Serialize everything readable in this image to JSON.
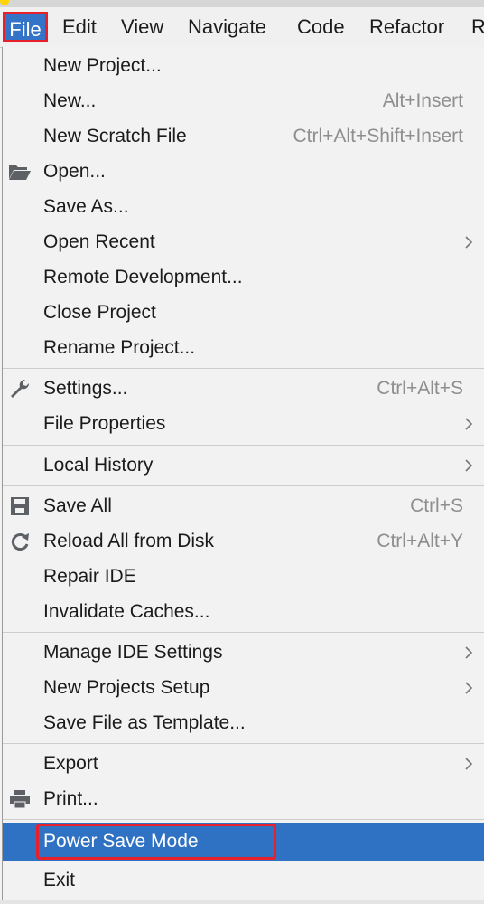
{
  "menubar": {
    "items": [
      "File",
      "Edit",
      "View",
      "Navigate",
      "Code",
      "Refactor",
      "R"
    ]
  },
  "file_menu": {
    "items": [
      {
        "label": "New Project...",
        "shortcut": "",
        "submenu": false
      },
      {
        "label": "New...",
        "shortcut": "Alt+Insert",
        "submenu": false
      },
      {
        "label": "New Scratch File",
        "shortcut": "Ctrl+Alt+Shift+Insert",
        "submenu": false
      },
      {
        "label": "Open...",
        "shortcut": "",
        "submenu": false,
        "icon": "folder-open-icon"
      },
      {
        "label": "Save As...",
        "shortcut": "",
        "submenu": false
      },
      {
        "label": "Open Recent",
        "shortcut": "",
        "submenu": true
      },
      {
        "label": "Remote Development...",
        "shortcut": "",
        "submenu": false
      },
      {
        "label": "Close Project",
        "shortcut": "",
        "submenu": false
      },
      {
        "label": "Rename Project...",
        "shortcut": "",
        "submenu": false
      },
      {
        "label": "Settings...",
        "shortcut": "Ctrl+Alt+S",
        "submenu": false,
        "icon": "wrench-icon"
      },
      {
        "label": "File Properties",
        "shortcut": "",
        "submenu": true
      },
      {
        "label": "Local History",
        "shortcut": "",
        "submenu": true
      },
      {
        "label": "Save All",
        "shortcut": "Ctrl+S",
        "submenu": false,
        "icon": "save-icon"
      },
      {
        "label": "Reload All from Disk",
        "shortcut": "Ctrl+Alt+Y",
        "submenu": false,
        "icon": "reload-icon"
      },
      {
        "label": "Repair IDE",
        "shortcut": "",
        "submenu": false
      },
      {
        "label": "Invalidate Caches...",
        "shortcut": "",
        "submenu": false
      },
      {
        "label": "Manage IDE Settings",
        "shortcut": "",
        "submenu": true
      },
      {
        "label": "New Projects Setup",
        "shortcut": "",
        "submenu": true
      },
      {
        "label": "Save File as Template...",
        "shortcut": "",
        "submenu": false
      },
      {
        "label": "Export",
        "shortcut": "",
        "submenu": true
      },
      {
        "label": "Print...",
        "shortcut": "",
        "submenu": false,
        "icon": "print-icon"
      },
      {
        "label": "Power Save Mode",
        "shortcut": "",
        "submenu": false,
        "highlighted": true
      },
      {
        "label": "Exit",
        "shortcut": "",
        "submenu": false
      }
    ]
  },
  "colors": {
    "highlight": "#2f72c4",
    "annotation_red": "#e8202c",
    "menu_bg": "#f2f2f2",
    "shortcut_text": "#8e8e8e"
  }
}
